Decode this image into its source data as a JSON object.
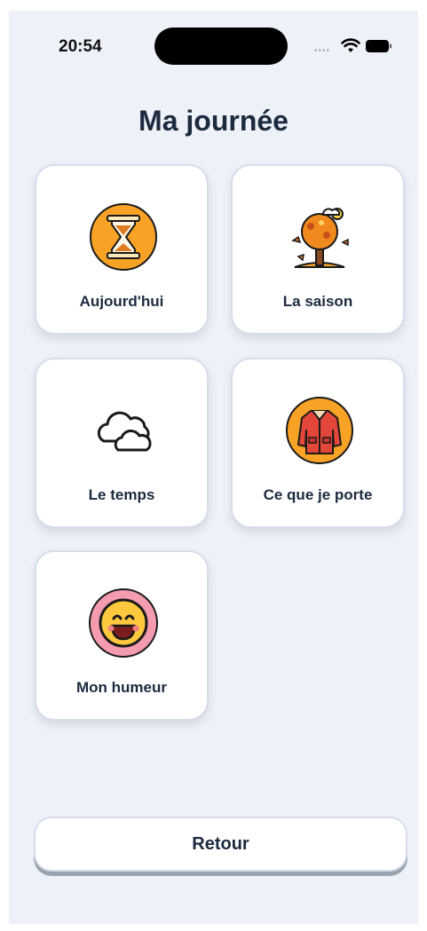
{
  "status_bar": {
    "time": "20:54"
  },
  "header": {
    "title": "Ma journée"
  },
  "menu": {
    "items": [
      {
        "label": "Aujourd'hui",
        "icon": "hourglass-icon"
      },
      {
        "label": "La saison",
        "icon": "autumn-tree-icon"
      },
      {
        "label": "Le temps",
        "icon": "cloud-icon"
      },
      {
        "label": "Ce que je porte",
        "icon": "coat-icon"
      },
      {
        "label": "Mon humeur",
        "icon": "smiley-face-icon"
      }
    ]
  },
  "footer": {
    "back_label": "Retour"
  },
  "colors": {
    "background": "#eef2f8",
    "card": "#ffffff",
    "text": "#1c2a3f",
    "accent_orange": "#f8a226",
    "accent_pink": "#f59bb0"
  }
}
